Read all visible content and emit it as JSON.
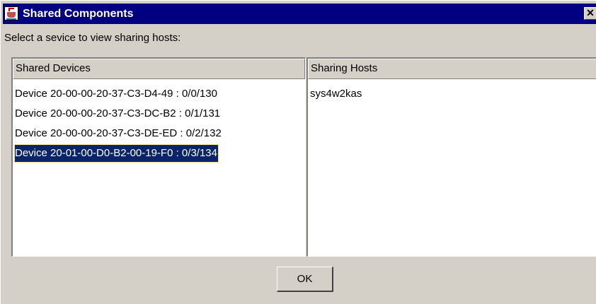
{
  "window": {
    "title": "Shared Components",
    "title_bar_color": "#000080",
    "app_icon": "java-coffee-cup-icon",
    "close_label": "✕"
  },
  "instruction": "Select a sevice to view sharing hosts:",
  "shared_devices": {
    "header": "Shared Devices",
    "items": [
      "Device 20-00-00-20-37-C3-D4-49 : 0/0/130",
      "Device 20-00-00-20-37-C3-DC-B2 : 0/1/131",
      "Device 20-00-00-20-37-C3-DE-ED : 0/2/132",
      "Device 20-01-00-D0-B2-00-19-F0 : 0/3/134"
    ],
    "selected_index": 3,
    "selection_color": "#0a246a"
  },
  "sharing_hosts": {
    "header": "Sharing Hosts",
    "items": [
      "sys4w2kas"
    ]
  },
  "buttons": {
    "ok_label": "OK"
  }
}
